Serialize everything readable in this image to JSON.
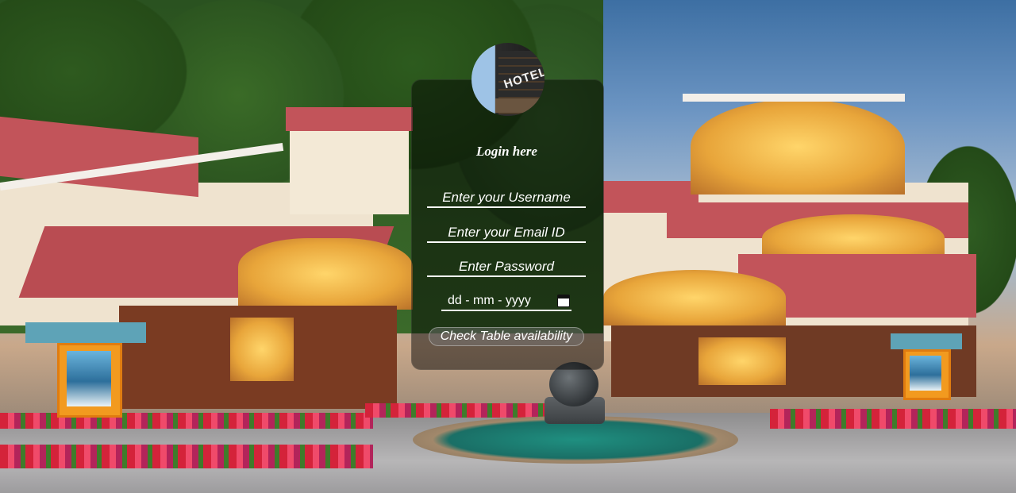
{
  "login": {
    "title": "Login here",
    "username_placeholder": "Enter your Username",
    "email_placeholder": "Enter your Email ID",
    "password_placeholder": "Enter Password",
    "date_placeholder": "dd - mm - yyyy",
    "submit_label": "Check Table availability"
  },
  "avatar": {
    "sign_text": "HOTEL"
  },
  "icons": {
    "calendar": "calendar-icon"
  }
}
